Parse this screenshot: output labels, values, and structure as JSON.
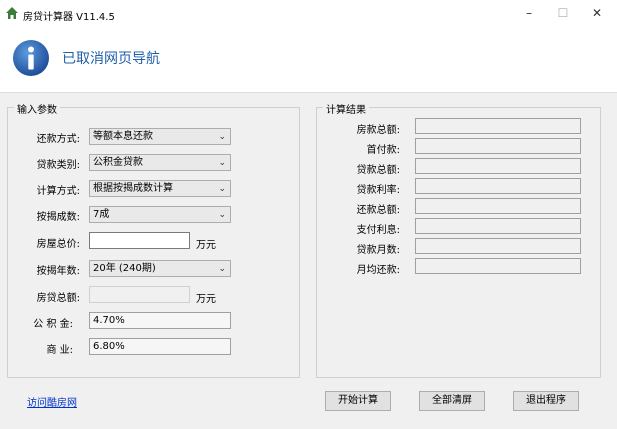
{
  "window": {
    "title": "房贷计算器 V11.4.5",
    "minimize": "–",
    "maximize": "☐",
    "close": "✕"
  },
  "banner": {
    "text": "已取消网页导航"
  },
  "inputs": {
    "group_title": "输入参数",
    "repayment_method": {
      "label": "还款方式:",
      "value": "等额本息还款"
    },
    "loan_type": {
      "label": "贷款类别:",
      "value": "公积金贷款"
    },
    "calc_method": {
      "label": "计算方式:",
      "value": "根据按揭成数计算"
    },
    "mortgage_ratio": {
      "label": "按揭成数:",
      "value": "7成"
    },
    "house_price": {
      "label": "房屋总价:",
      "value": "",
      "unit": "万元"
    },
    "mortgage_years": {
      "label": "按揭年数:",
      "value": "20年 (240期)"
    },
    "loan_total": {
      "label": "房贷总额:",
      "value": "",
      "unit": "万元"
    },
    "fund_rate": {
      "label": "公 积 金:",
      "value": "4.70%"
    },
    "commercial_rate": {
      "label": "商 业:",
      "value": "6.80%"
    }
  },
  "results": {
    "group_title": "计算结果",
    "items": [
      {
        "label": "房款总额:"
      },
      {
        "label": "首付款:"
      },
      {
        "label": "贷款总额:"
      },
      {
        "label": "贷款利率:"
      },
      {
        "label": "还款总额:"
      },
      {
        "label": "支付利息:"
      },
      {
        "label": "贷款月数:"
      },
      {
        "label": "月均还款:"
      }
    ]
  },
  "footer": {
    "link": "访问酷房网",
    "calculate": "开始计算",
    "clear": "全部清屏",
    "exit": "退出程序"
  },
  "colors": {
    "banner_text": "#1f5fa8",
    "info_icon": "#1f5fa8",
    "link": "#0033cc"
  }
}
